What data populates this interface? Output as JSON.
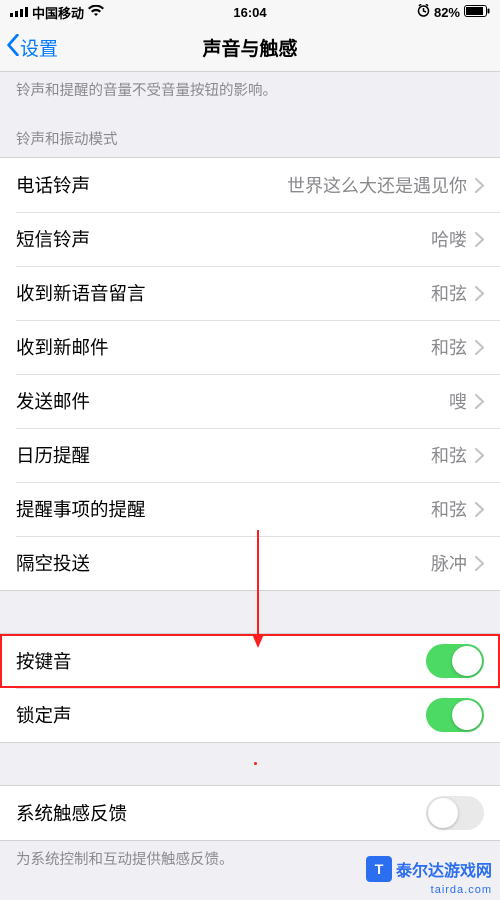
{
  "status": {
    "signal_label": "signal-icon",
    "carrier": "中国移动",
    "wifi_label": "wifi-icon",
    "time": "16:04",
    "alarm_label": "alarm-icon",
    "battery_pct": "82%",
    "battery_label": "battery-icon"
  },
  "nav": {
    "back": "设置",
    "title": "声音与触感"
  },
  "top_hint": "铃声和提醒的音量不受音量按钮的影响。",
  "section_ringtone_header": "铃声和振动模式",
  "ringtone_rows": [
    {
      "label": "电话铃声",
      "value": "世界这么大还是遇见你"
    },
    {
      "label": "短信铃声",
      "value": "哈喽"
    },
    {
      "label": "收到新语音留言",
      "value": "和弦"
    },
    {
      "label": "收到新邮件",
      "value": "和弦"
    },
    {
      "label": "发送邮件",
      "value": "嗖"
    },
    {
      "label": "日历提醒",
      "value": "和弦"
    },
    {
      "label": "提醒事项的提醒",
      "value": "和弦"
    },
    {
      "label": "隔空投送",
      "value": "脉冲"
    }
  ],
  "switch_rows": [
    {
      "label": "按键音",
      "on": true,
      "highlight": true,
      "name": "keyboard-clicks-toggle"
    },
    {
      "label": "锁定声",
      "on": true,
      "highlight": false,
      "name": "lock-sound-toggle"
    }
  ],
  "haptics_rows": [
    {
      "label": "系统触感反馈",
      "on": false,
      "name": "system-haptics-toggle"
    }
  ],
  "haptics_hint": "为系统控制和互动提供触感反馈。",
  "watermark": {
    "brand": "泰尔达游戏网",
    "sub": "tairda.com",
    "logo_initial": "T"
  },
  "colors": {
    "accent": "#007aff",
    "switch_on": "#4cd964",
    "highlight": "#ff1e1e"
  }
}
